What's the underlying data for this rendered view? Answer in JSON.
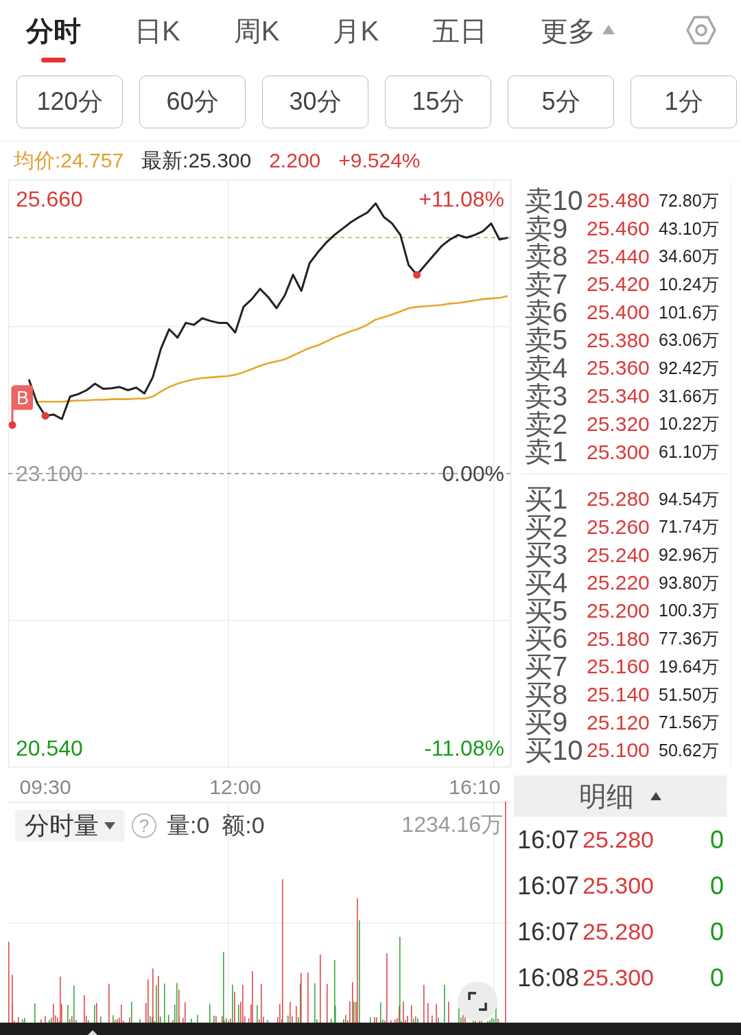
{
  "tabs": [
    {
      "label": "分时",
      "selected": true,
      "kind": "tab"
    },
    {
      "label": "日K",
      "selected": false,
      "kind": "tab"
    },
    {
      "label": "周K",
      "selected": false,
      "kind": "tab"
    },
    {
      "label": "月K",
      "selected": false,
      "kind": "tab"
    },
    {
      "label": "五日",
      "selected": false,
      "kind": "tab"
    },
    {
      "label": "更多",
      "selected": false,
      "kind": "menu"
    }
  ],
  "periods": [
    {
      "label": "120分",
      "selected": false
    },
    {
      "label": "60分",
      "selected": false
    },
    {
      "label": "30分",
      "selected": false
    },
    {
      "label": "15分",
      "selected": false
    },
    {
      "label": "5分",
      "selected": false
    },
    {
      "label": "1分",
      "selected": false
    }
  ],
  "quote": {
    "average": "均价:24.757",
    "latest": "最新:25.300",
    "change": "2.200",
    "change_percent": "+9.524%"
  },
  "chart": {
    "right_labels": [
      "+11.08%",
      "0.00%",
      "-11.08%"
    ],
    "chart_data": {
      "type": "line",
      "categories": [
        null,
        null,
        null,
        null,
        "09:30",
        null,
        null,
        null,
        null,
        null,
        null,
        null,
        null,
        null,
        null,
        null,
        null,
        null,
        null,
        null,
        null,
        null,
        null,
        null,
        null,
        null,
        null,
        "12:00",
        null,
        null,
        null,
        null,
        null,
        null,
        null,
        null,
        null,
        null,
        null,
        null,
        null,
        null,
        null,
        null,
        null,
        null,
        null,
        null,
        null,
        null,
        null,
        null,
        null,
        null,
        null,
        null,
        "16:10",
        null,
        null,
        null,
        null
      ],
      "ylim": [
        20.36,
        25.84
      ],
      "yticks": [
        {
          "value": 25.66,
          "label": "25.660"
        },
        {
          "value": 23.1,
          "label": "23.100"
        },
        {
          "value": 20.54,
          "label": "20.540"
        }
      ],
      "series": [
        {
          "color": "#e8a628",
          "values": [
            null,
            null,
            null,
            23.77,
            23.77,
            23.77,
            23.77,
            23.776,
            23.782,
            23.782,
            23.788,
            23.788,
            23.794,
            23.794,
            23.794,
            23.8,
            23.8,
            23.818,
            23.866,
            23.908,
            23.938,
            23.961,
            23.979,
            23.991,
            23.997,
            24.003,
            24.009,
            24.021,
            24.045,
            24.075,
            24.105,
            24.129,
            24.147,
            24.165,
            24.201,
            24.237,
            24.272,
            24.296,
            24.332,
            24.368,
            24.398,
            24.428,
            24.452,
            24.488,
            24.536,
            24.56,
            24.583,
            24.613,
            24.643,
            24.655,
            24.661,
            24.667,
            24.673,
            24.685,
            24.691,
            24.703,
            24.715,
            24.727,
            24.733,
            24.739,
            24.757
          ]
        },
        {
          "color": "#222222",
          "values": [
            null,
            null,
            23.979,
            23.758,
            23.638,
            23.65,
            23.609,
            23.818,
            23.842,
            23.878,
            23.938,
            23.89,
            23.896,
            23.908,
            23.878,
            23.902,
            23.848,
            23.997,
            24.266,
            24.446,
            24.368,
            24.506,
            24.488,
            24.548,
            24.524,
            24.506,
            24.506,
            24.416,
            24.655,
            24.727,
            24.823,
            24.745,
            24.643,
            24.763,
            24.954,
            24.805,
            25.062,
            25.164,
            25.253,
            25.325,
            25.385,
            25.445,
            25.493,
            25.534,
            25.62,
            25.493,
            25.433,
            25.325,
            25.044,
            24.954,
            25.044,
            25.134,
            25.223,
            25.283,
            25.325,
            25.301,
            25.325,
            25.361,
            25.433,
            25.283,
            25.3
          ]
        }
      ],
      "ref_lines": [
        {
          "axis": "y",
          "value": 25.3,
          "color": "#c9a46a"
        },
        {
          "axis": "y",
          "value": 23.1,
          "color": "#888888"
        }
      ],
      "annotations": [
        "B"
      ]
    }
  },
  "order_book": {
    "asks": [
      {
        "label": "卖10",
        "price": "25.480",
        "volume": "72.80万"
      },
      {
        "label": "卖9",
        "price": "25.460",
        "volume": "43.10万"
      },
      {
        "label": "卖8",
        "price": "25.440",
        "volume": "34.60万"
      },
      {
        "label": "卖7",
        "price": "25.420",
        "volume": "10.24万"
      },
      {
        "label": "卖6",
        "price": "25.400",
        "volume": "101.6万"
      },
      {
        "label": "卖5",
        "price": "25.380",
        "volume": "63.06万"
      },
      {
        "label": "卖4",
        "price": "25.360",
        "volume": "92.42万"
      },
      {
        "label": "卖3",
        "price": "25.340",
        "volume": "31.66万"
      },
      {
        "label": "卖2",
        "price": "25.320",
        "volume": "10.22万"
      },
      {
        "label": "卖1",
        "price": "25.300",
        "volume": "61.10万"
      }
    ],
    "bids": [
      {
        "label": "买1",
        "price": "25.280",
        "volume": "94.54万"
      },
      {
        "label": "买2",
        "price": "25.260",
        "volume": "71.74万"
      },
      {
        "label": "买3",
        "price": "25.240",
        "volume": "92.96万"
      },
      {
        "label": "买4",
        "price": "25.220",
        "volume": "93.80万"
      },
      {
        "label": "买5",
        "price": "25.200",
        "volume": "100.3万"
      },
      {
        "label": "买6",
        "price": "25.180",
        "volume": "77.36万"
      },
      {
        "label": "买7",
        "price": "25.160",
        "volume": "19.64万"
      },
      {
        "label": "买8",
        "price": "25.140",
        "volume": "51.50万"
      },
      {
        "label": "买9",
        "price": "25.120",
        "volume": "71.56万"
      },
      {
        "label": "买10",
        "price": "25.100",
        "volume": "50.62万"
      }
    ]
  },
  "volume": {
    "selector": "分时量",
    "help": "?",
    "volume": "量:0",
    "amount": "额:0",
    "max": "1234.16万"
  },
  "detail": {
    "title": "明细",
    "trades": [
      {
        "time": "16:07",
        "price": "25.280",
        "volume": "0"
      },
      {
        "time": "16:07",
        "price": "25.300",
        "volume": "0"
      },
      {
        "time": "16:07",
        "price": "25.280",
        "volume": "0"
      },
      {
        "time": "16:08",
        "price": "25.300",
        "volume": "0"
      }
    ]
  }
}
